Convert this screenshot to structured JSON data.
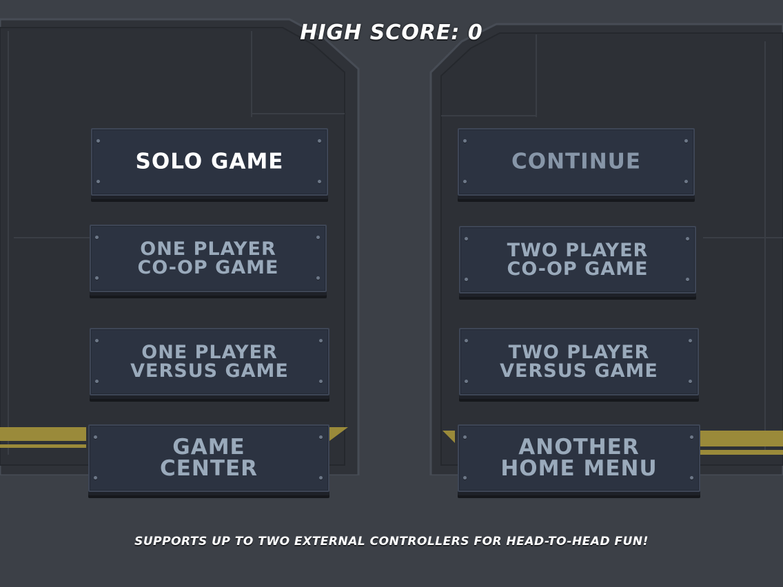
{
  "header": {
    "high_score_label": "HIGH SCORE: 0"
  },
  "menu": {
    "solo_game": "SOLO GAME",
    "continue": "CONTINUE",
    "one_player_coop": "ONE PLAYER\nCO-OP GAME",
    "two_player_coop": "TWO PLAYER\nCO-OP GAME",
    "one_player_versus": "ONE PLAYER\nVERSUS GAME",
    "two_player_versus": "TWO PLAYER\nVERSUS GAME",
    "game_center": "GAME\nCENTER",
    "another_home_menu": "ANOTHER\nHOME MENU"
  },
  "footer": {
    "text": "SUPPORTS UP TO TWO EXTERNAL CONTROLLERS FOR HEAD-TO-HEAD FUN!"
  },
  "colors": {
    "background": "#3c4047",
    "panel": "#2f3238",
    "button_face": "#2c3341",
    "button_text": "#9aaabb",
    "button_text_active": "#ffffff",
    "hazard_stripe": "#9a8a3a"
  }
}
